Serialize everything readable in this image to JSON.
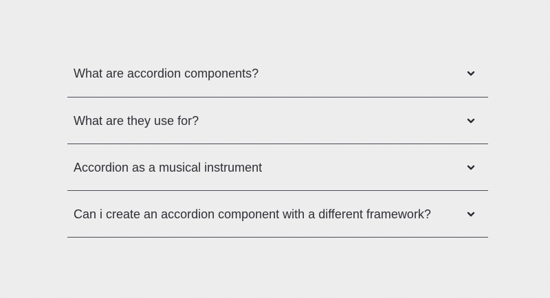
{
  "accordion": {
    "items": [
      {
        "question": "What are accordion components?",
        "icon": "chevron-down-icon",
        "expanded": false
      },
      {
        "question": "What are they use for?",
        "icon": "chevron-down-icon",
        "expanded": false
      },
      {
        "question": "Accordion as a musical instrument",
        "icon": "chevron-down-icon",
        "expanded": false
      },
      {
        "question": "Can i create an accordion component with a different framework?",
        "icon": "chevron-down-icon",
        "expanded": false
      }
    ]
  }
}
